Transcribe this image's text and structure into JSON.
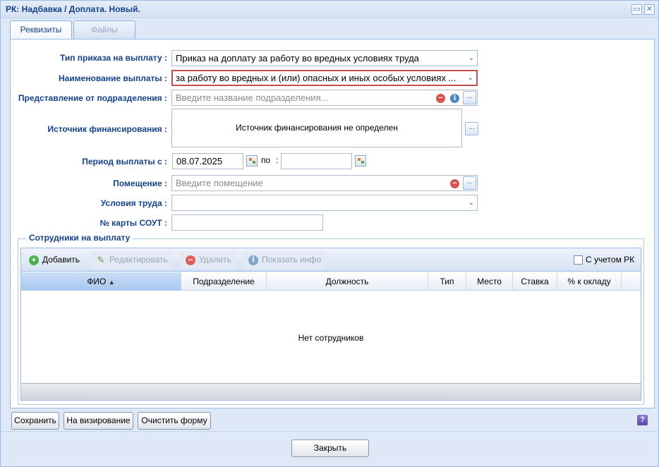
{
  "window": {
    "title": "РК: Надбавка / Доплата. Новый."
  },
  "tabs": [
    {
      "label": "Реквизиты"
    },
    {
      "label": "Файлы"
    }
  ],
  "form": {
    "order_type": {
      "label": "Тип приказа на выплату :",
      "value": "Приказ на доплату за работу во вредных условиях труда"
    },
    "payment_name": {
      "label": "Наименование выплаты :",
      "value": "за работу во вредных и (или) опасных и иных особых условиях ..."
    },
    "department": {
      "label": "Представление от подразделения :",
      "placeholder": "Введите название подразделения..."
    },
    "funding": {
      "label": "Источник финансирования :",
      "value": "Источник финансирования не определен"
    },
    "period": {
      "label": "Период выплаты с :",
      "from": "08.07.2025",
      "to_label": "по",
      "to_sep": ":",
      "to": ""
    },
    "room": {
      "label": "Помещение :",
      "placeholder": "Введите помещение"
    },
    "conditions": {
      "label": "Условия труда :",
      "value": ""
    },
    "sout_card": {
      "label": "№ карты СОУТ :",
      "value": ""
    }
  },
  "employees": {
    "legend": "Сотрудники на выплату",
    "toolbar": {
      "add": "Добавить",
      "edit": "Редактировать",
      "delete": "Удалить",
      "info": "Показать инфо",
      "with_rk": "С учетом РК"
    },
    "columns": [
      "ФИО",
      "Подразделение",
      "Должность",
      "Тип",
      "Место",
      "Ставка",
      "% к окладу"
    ],
    "sort_indicator": "▲",
    "empty_text": "Нет сотрудников"
  },
  "actions": {
    "save": "Сохранить",
    "to_approval": "На визирование",
    "clear": "Очистить форму",
    "close": "Закрыть",
    "help": "?"
  },
  "icons": {
    "dropdown": "chevron-down-icon",
    "remove": "minus-circle-icon",
    "info": "info-icon",
    "ellipsis": "ellipsis-icon",
    "calendar": "calendar-icon"
  },
  "colors": {
    "accent": "#15428b",
    "invalid_border": "#c0504d",
    "panel_bg": "#dfe8f6"
  }
}
